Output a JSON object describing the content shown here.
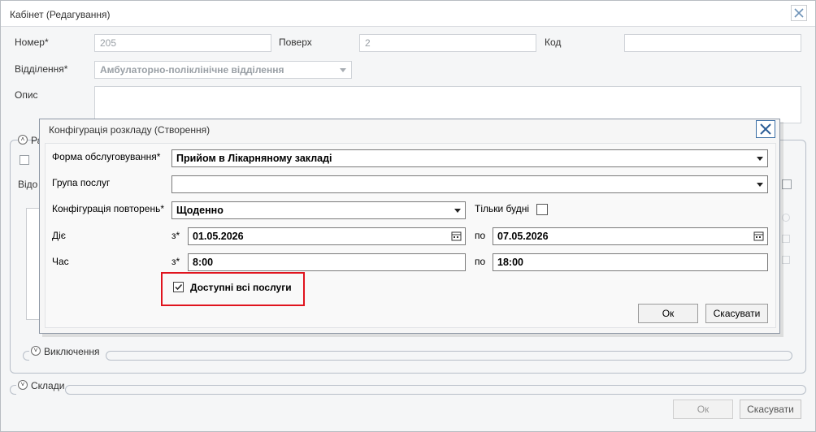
{
  "main_dialog": {
    "title": "Кабінет (Редагування)",
    "labels": {
      "number": "Номер*",
      "floor": "Поверх",
      "code": "Код",
      "department": "Відділення*",
      "description": "Опис"
    },
    "values": {
      "number": "205",
      "floor": "2",
      "code": "",
      "department": "Амбулаторно-поліклінічне відділення",
      "description": ""
    },
    "partial": {
      "group_label_fragment": "Ра",
      "row_label_fragment": "Відо"
    },
    "sections": {
      "exclusions": "Виключення",
      "warehouses": "Склади"
    },
    "ok_label": "Ок",
    "cancel_label": "Скасувати"
  },
  "schedule_dialog": {
    "title": "Конфігурація розкладу (Створення)",
    "labels": {
      "service_form": "Форма обслуговування*",
      "service_group": "Група послуг",
      "repeat_config": "Конфігурація повторень*",
      "weekdays_only": "Тільки будні",
      "valid": "Діє",
      "time": "Час",
      "from": "з*",
      "to": "по"
    },
    "values": {
      "service_form": "Прийом в Лікарняному закладі",
      "service_group": "",
      "repeat_config": "Щоденно",
      "weekdays_only": false,
      "valid_from": "01.05.2026",
      "valid_to": "07.05.2026",
      "time_from": "8:00",
      "time_to": "18:00"
    },
    "all_services_label": "Доступні всі послуги",
    "all_services_checked": true,
    "highlight_color": "#e0141e",
    "ok_label": "Ок",
    "cancel_label": "Скасувати"
  }
}
